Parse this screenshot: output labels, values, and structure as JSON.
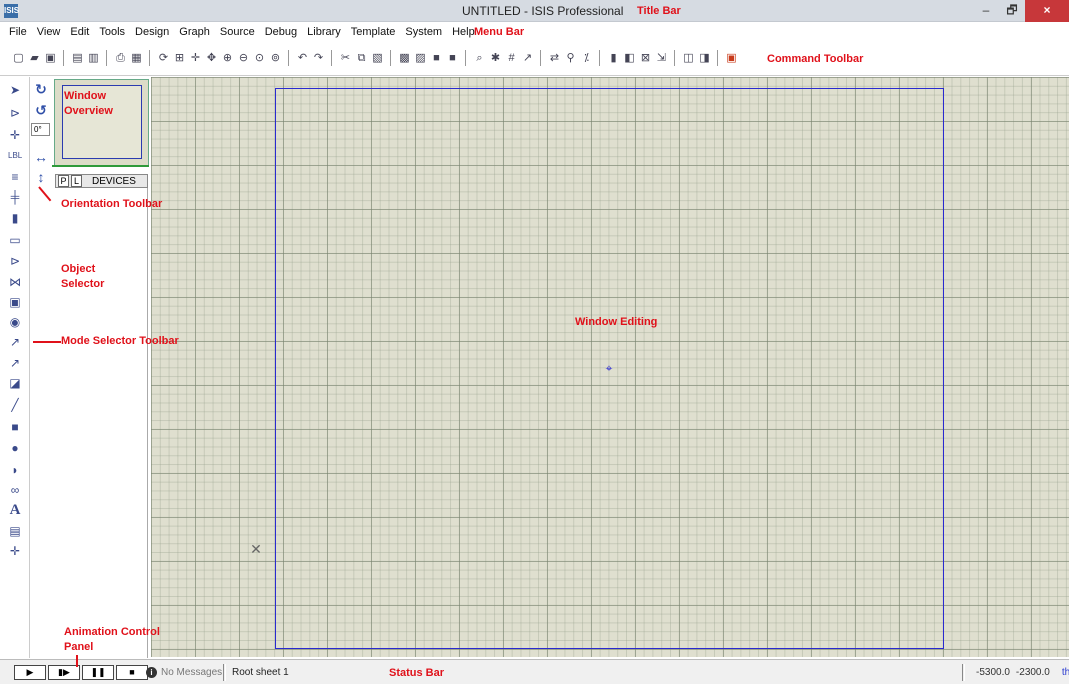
{
  "window": {
    "app_icon_text": "ISIS",
    "title": "UNTITLED - ISIS Professional",
    "controls": {
      "minimize": "–",
      "restore": "🗗",
      "close": "×"
    }
  },
  "menu": [
    "File",
    "View",
    "Edit",
    "Tools",
    "Design",
    "Graph",
    "Source",
    "Debug",
    "Library",
    "Template",
    "System",
    "Help"
  ],
  "orientation": {
    "angle_value": "0°"
  },
  "object_selector": {
    "p_button": "P",
    "l_button": "L",
    "title": "DEVICES"
  },
  "status": {
    "message": "No Messages",
    "sheet": "Root sheet 1",
    "coord_x": "-5300.0",
    "coord_y": "-2300.0",
    "unit": "th"
  },
  "annotations": {
    "title_bar": "Title Bar",
    "menu_bar": "Menu Bar",
    "command_toolbar": "Command Toolbar",
    "window_overview": "Window\nOverview",
    "orientation_toolbar": "Orientation Toolbar",
    "object_selector": "Object\nSelector",
    "mode_selector_toolbar": "Mode Selector Toolbar",
    "window_editing": "Window Editing",
    "animation_control_panel": "Animation Control\nPanel",
    "status_bar": "Status Bar"
  },
  "colors": {
    "annotation": "#e0111a",
    "canvas": "#dfdfcf",
    "sheet_border": "#2a2ad0"
  }
}
